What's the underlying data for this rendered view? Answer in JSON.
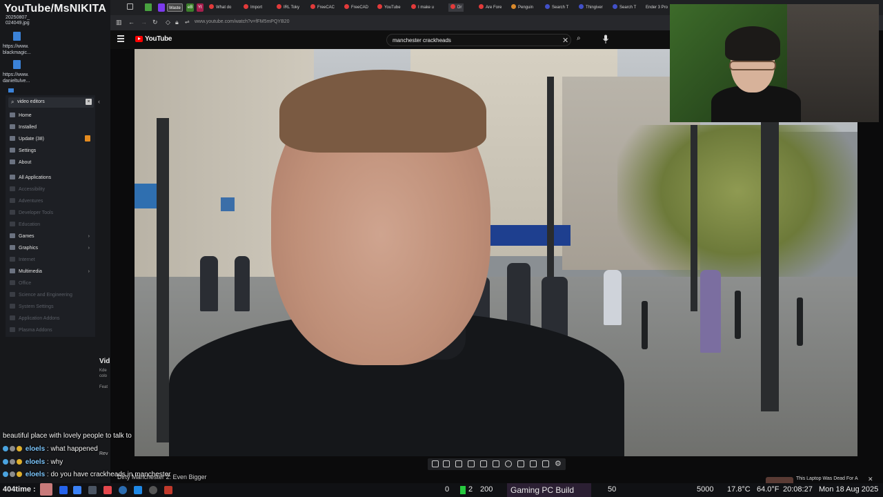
{
  "desktop": {
    "brand": "YouTube/MsNIKITA",
    "files": [
      "20250807_",
      "024049.jpg",
      "https://www.",
      "blackmagic...",
      "https://www.",
      "danieltulve..."
    ]
  },
  "app_menu": {
    "search_value": "video editors",
    "items": [
      {
        "label": "Home",
        "dim": false
      },
      {
        "label": "Installed",
        "dim": false
      },
      {
        "label": "Update (38)",
        "dim": false
      },
      {
        "label": "Settings",
        "dim": false
      },
      {
        "label": "About",
        "dim": false
      },
      {
        "label": "All Applications",
        "dim": false
      },
      {
        "label": "Accessibility",
        "dim": true
      },
      {
        "label": "Adventures",
        "dim": true
      },
      {
        "label": "Developer Tools",
        "dim": true
      },
      {
        "label": "Education",
        "dim": true
      },
      {
        "label": "Games",
        "dim": false
      },
      {
        "label": "Graphics",
        "dim": false
      },
      {
        "label": "Internet",
        "dim": true
      },
      {
        "label": "Multimedia",
        "dim": false
      },
      {
        "label": "Office",
        "dim": true
      },
      {
        "label": "Science and Engineering",
        "dim": true
      },
      {
        "label": "System Settings",
        "dim": true
      },
      {
        "label": "Application Addons",
        "dim": true
      },
      {
        "label": "Plasma Addons",
        "dim": true
      }
    ]
  },
  "browser": {
    "tabs": [
      "Waste",
      "eB",
      "Yt",
      "What do",
      "Import",
      "IRL Toky",
      "FreeCAC",
      "FreeCAD",
      "YouTube",
      "I make u",
      "Dr",
      "Are Fore",
      "Penguin",
      "Search T",
      "Thingiver",
      "Search T",
      "Ender 3 Pro"
    ],
    "url": "www.youtube.com/watch?v=fFM5mPQYB20"
  },
  "youtube": {
    "logo_text": "YouTube",
    "search_query": "manchester crackheads"
  },
  "left_overlay": {
    "vid_title": "Vid",
    "vid_desc": [
      "Kde",
      "colo",
      "Feat"
    ],
    "rev": "Rev"
  },
  "chat": {
    "lines": [
      {
        "name": "",
        "text": "beautiful place with lovely people to talk to"
      },
      {
        "name": "eloels",
        "text": " : what happened"
      },
      {
        "name": "eloels",
        "text": " : why"
      },
      {
        "name": "eloels",
        "text": " : do you have crackheads in manchester"
      }
    ],
    "under_text": "Dirty Manchester 2: Even Bigger"
  },
  "taskbar": {
    "user": "404time :",
    "stat_zero": "0",
    "stat_two": "2",
    "stat_200": "200",
    "window_title": "Gaming PC Build",
    "value_50": "50",
    "value_5000": "5000",
    "weather": "17.8°C",
    "temp_f": "64.0°F",
    "time": "20:08:27",
    "date": "Mon 18 Aug 2025",
    "notification": "This Laptop Was Dead For A"
  },
  "colors": {
    "chat_name": "#7ec8ff",
    "youtube_red": "#ff0000",
    "update_badge": "#e58b1f"
  }
}
